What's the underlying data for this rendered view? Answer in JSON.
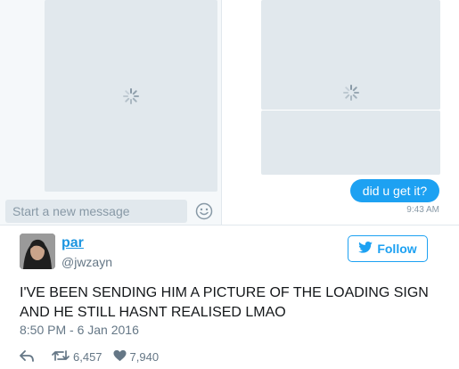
{
  "dm": {
    "message_bubble": "did u get it?",
    "message_time": "9:43 AM",
    "composer_placeholder": "Start a new message"
  },
  "tweet": {
    "display_name": "par",
    "handle": "@jwzayn",
    "follow_label": "Follow",
    "text": "I'VE BEEN SENDING HIM A PICTURE OF THE LOADING SIGN AND HE STILL HASNT REALISED LMAO",
    "timestamp": "8:50 PM - 6 Jan 2016",
    "retweets": "6,457",
    "likes": "7,940"
  },
  "colors": {
    "brand_blue": "#1da1f2",
    "link_blue": "#1b95e0",
    "image_placeholder": "#e1e8ed",
    "muted_text": "#657786"
  },
  "icons": [
    "loading-spinner-icon",
    "smiley-icon",
    "twitter-bird-icon",
    "reply-icon",
    "retweet-icon",
    "heart-icon"
  ]
}
